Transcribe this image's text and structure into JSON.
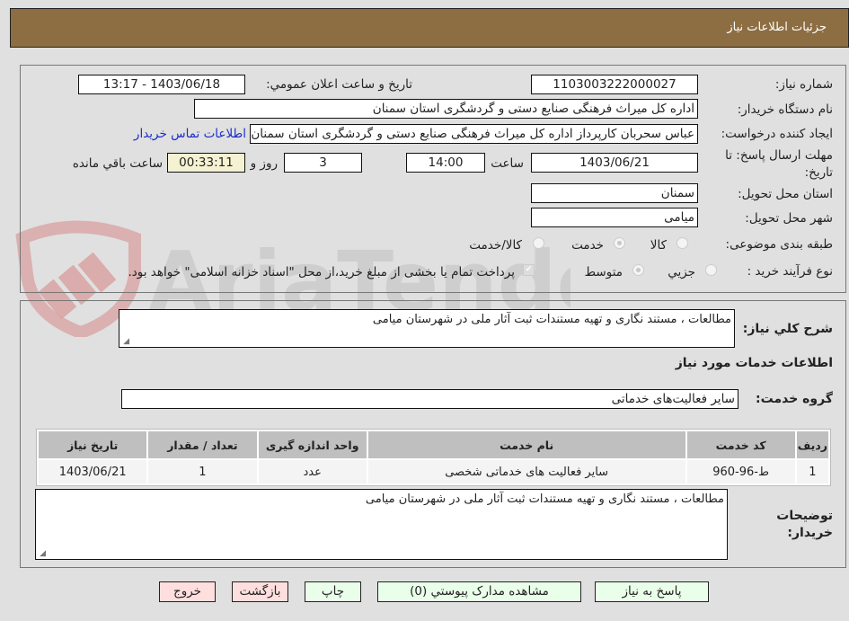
{
  "header": {
    "title": "جزئیات اطلاعات نیاز"
  },
  "form": {
    "need_number": {
      "label": "شماره نیاز:",
      "value": "1103003222000027"
    },
    "announce_datetime": {
      "label": "تاريخ و ساعت اعلان عمومي:",
      "value": "1403/06/18 - 13:17"
    },
    "buyer_org": {
      "label": "نام دستگاه خریدار:",
      "value": "اداره کل میراث فرهنگی  صنایع دستی و گردشگری استان سمنان"
    },
    "requester": {
      "label": "ایجاد کننده درخواست:",
      "value": "عباس سحربان کارپرداز اداره کل میراث فرهنگی  صنایع دستی و گردشگری استان سمنان"
    },
    "buyer_contact_link": "اطلاعات تماس خریدار",
    "deadline": {
      "label_line1": "مهلت ارسال پاسخ: تا",
      "label_line2": "تاریخ:",
      "date": "1403/06/21",
      "time_label": "ساعت",
      "time": "14:00",
      "days": "3",
      "days_label": "روز و",
      "remaining": "00:33:11",
      "remaining_label": "ساعت باقي مانده"
    },
    "province": {
      "label": "استان محل تحویل:",
      "value": "سمنان"
    },
    "city": {
      "label": "شهر محل تحویل:",
      "value": "میامی"
    },
    "category": {
      "label": "طبقه بندی موضوعی:",
      "options": [
        {
          "label": "کالا",
          "selected": false
        },
        {
          "label": "خدمت",
          "selected": true
        },
        {
          "label": "کالا/خدمت",
          "selected": false
        }
      ]
    },
    "purchase_type": {
      "label": "نوع فرآیند خرید :",
      "options": [
        {
          "label": "جزيي",
          "selected": false
        },
        {
          "label": "متوسط",
          "selected": true
        }
      ],
      "treasury_checkbox": {
        "checked": true,
        "label": "پرداخت تمام یا بخشی از مبلغ خرید،از محل \"اسناد خزانه اسلامی\" خواهد بود."
      }
    }
  },
  "details": {
    "description_label": "شرح کلي نیاز:",
    "description": "مطالعات ، مستند نگاری و تهیه مستندات ثبت آثار ملی در شهرستان میامی",
    "services_heading": "اطلاعات خدمات مورد نیاز",
    "service_group_label": "گروه خدمت:",
    "service_group": "سایر فعالیت‌های خدماتی",
    "table": {
      "headers": [
        "ردیف",
        "کد خدمت",
        "نام خدمت",
        "واحد اندازه گیری",
        "تعداد / مقدار",
        "تاریخ نیاز"
      ],
      "rows": [
        [
          "1",
          "ط-96-960",
          "سایر فعالیت های خدماتی شخصی",
          "عدد",
          "1",
          "1403/06/21"
        ]
      ]
    },
    "buyer_notes_label_line1": "توضیحات",
    "buyer_notes_label_line2": "خریدار:",
    "buyer_notes": "مطالعات ، مستند نگاری و تهیه مستندات ثبت آثار ملی در شهرستان میامی"
  },
  "buttons": {
    "respond": "پاسخ به نیاز",
    "attachments": "مشاهده مدارک پیوستي (0)",
    "print": "چاپ",
    "back": "بازگشت",
    "exit": "خروج"
  },
  "watermark": {
    "text": "AriaTender.neT"
  },
  "colors": {
    "header_bg": "#8d6e42",
    "green_button": "#eaffea",
    "pink_button": "#ffdede",
    "timer_bg": "#f5f2d3",
    "link": "#1a2dcc"
  }
}
